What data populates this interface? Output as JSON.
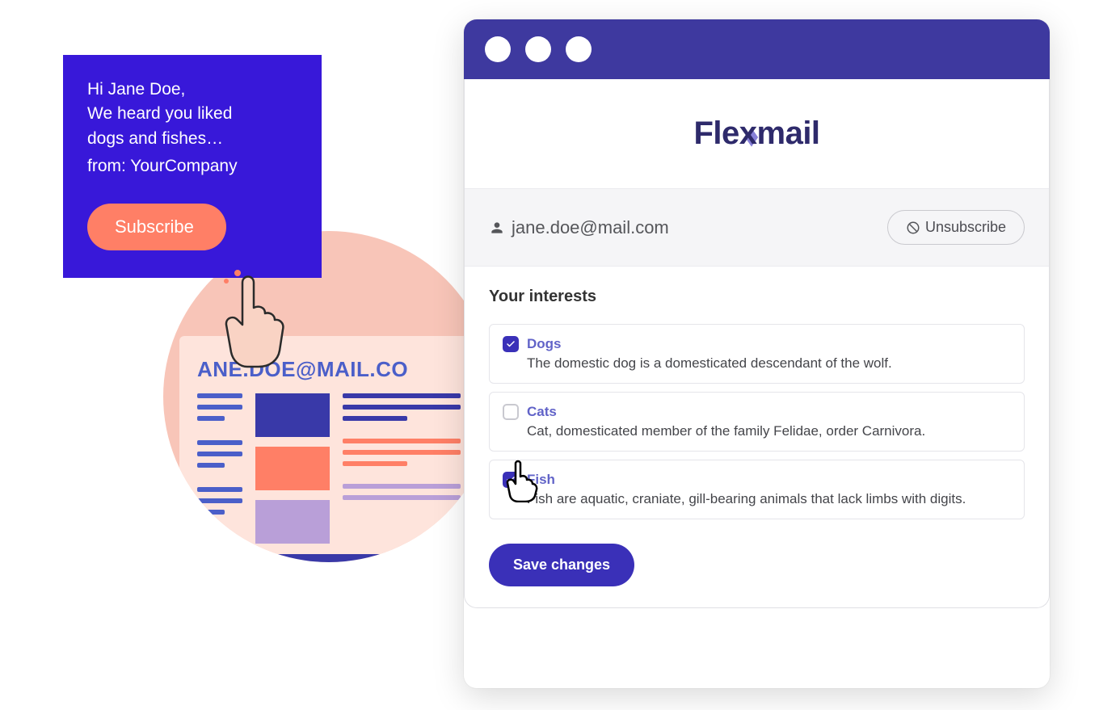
{
  "subscribe_card": {
    "greeting": "Hi Jane Doe,",
    "line2": "We heard you liked",
    "line3": "dogs and fishes…",
    "from_prefix": "from: ",
    "from_company": "YourCompany",
    "button": "Subscribe"
  },
  "illustration": {
    "email_caps": "ANE.DOE@MAIL.CO"
  },
  "browser": {
    "logo_text": "Flexmail",
    "user_email": "jane.doe@mail.com",
    "unsubscribe_label": "Unsubscribe",
    "section_title": "Your interests",
    "interests": [
      {
        "name": "Dogs",
        "desc": "The domestic dog is a domesticated descendant of the wolf.",
        "checked": true
      },
      {
        "name": "Cats",
        "desc": "Cat, domesticated member of the family Felidae, order Carnivora.",
        "checked": false
      },
      {
        "name": "Fish",
        "desc": "Fish are aquatic, craniate, gill-bearing animals that lack limbs with digits.",
        "checked": true
      }
    ],
    "save_label": "Save changes"
  }
}
